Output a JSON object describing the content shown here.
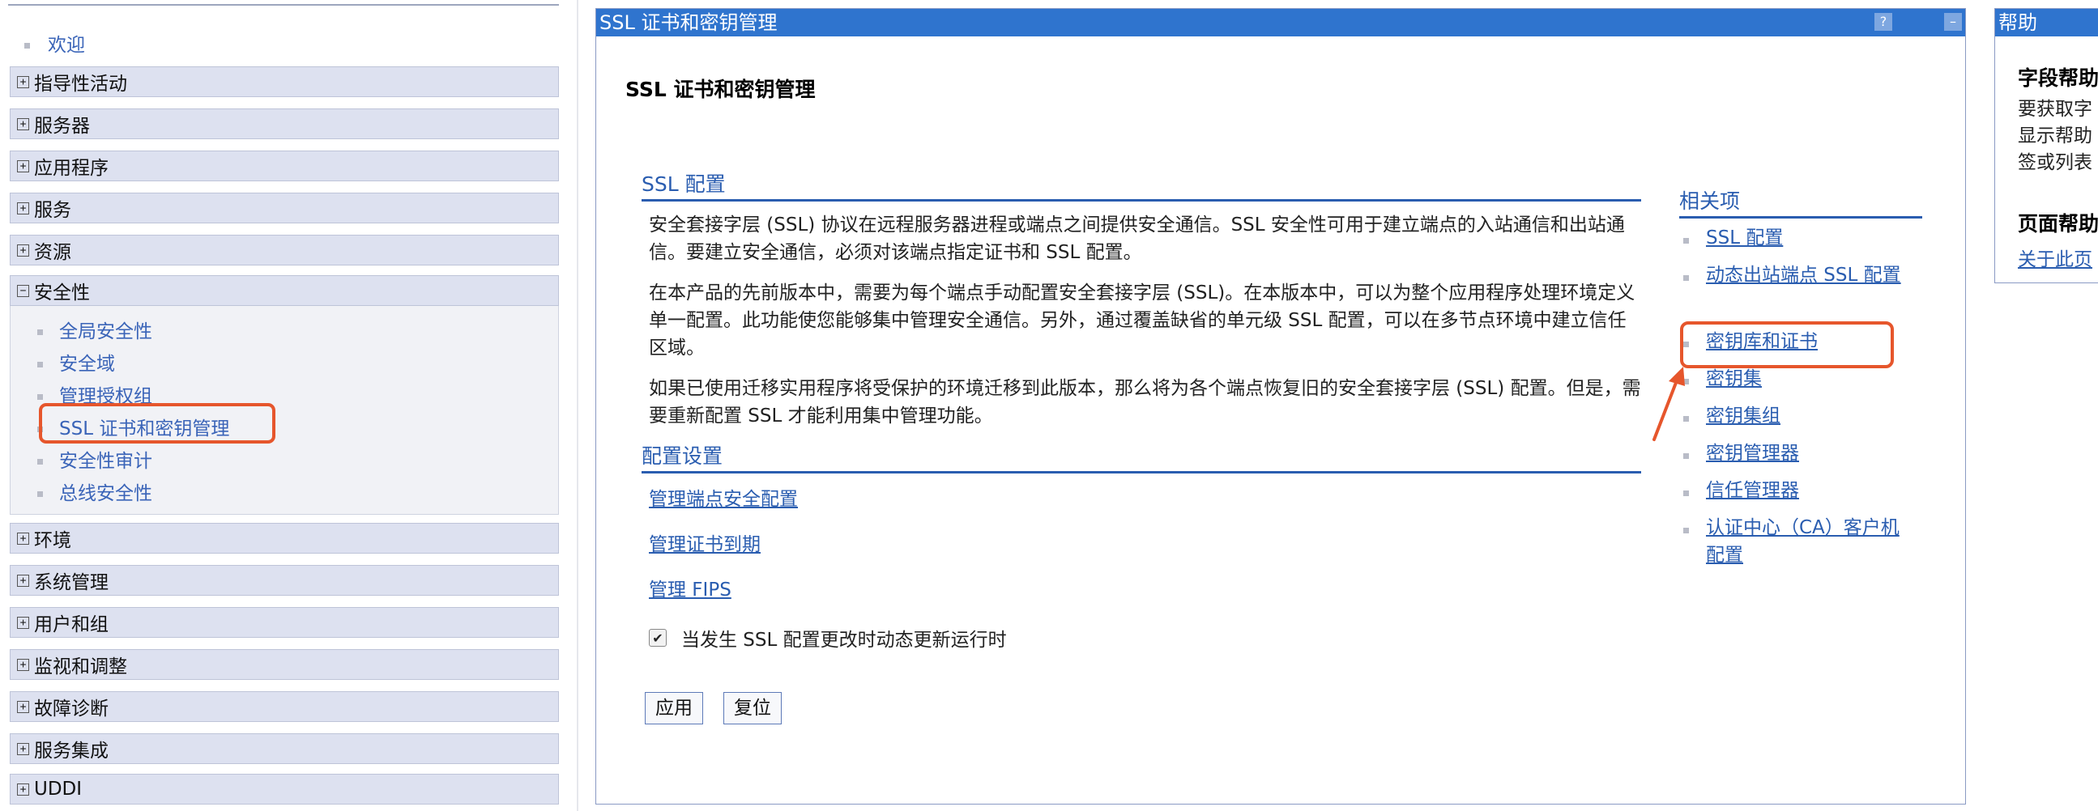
{
  "nav": {
    "welcome": "欢迎",
    "sections": [
      "指导性活动",
      "服务器",
      "应用程序",
      "服务",
      "资源"
    ],
    "security": {
      "label": "安全性",
      "items": [
        "全局安全性",
        "安全域",
        "管理授权组",
        "SSL 证书和密钥管理",
        "安全性审计",
        "总线安全性"
      ]
    },
    "sections_after": [
      "环境",
      "系统管理",
      "用户和组",
      "监视和调整",
      "故障诊断",
      "服务集成",
      "UDDI"
    ]
  },
  "main": {
    "title_bar": "SSL 证书和密钥管理",
    "help_btn": "?",
    "min_btn": "–",
    "heading": "SSL 证书和密钥管理",
    "ssl_config_heading": "SSL 配置",
    "paragraphs": [
      "安全套接字层 (SSL) 协议在远程服务器进程或端点之间提供安全通信。SSL 安全性可用于建立端点的入站通信和出站通信。要建立安全通信，必须对该端点指定证书和 SSL 配置。",
      "在本产品的先前版本中，需要为每个端点手动配置安全套接字层 (SSL)。在本版本中，可以为整个应用程序处理环境定义单一配置。此功能使您能够集中管理安全通信。另外，通过覆盖缺省的单元级 SSL 配置，可以在多节点环境中建立信任区域。",
      "如果已使用迁移实用程序将受保护的环境迁移到此版本，那么将为各个端点恢复旧的安全套接字层 (SSL) 配置。但是，需要重新配置 SSL 才能利用集中管理功能。"
    ],
    "config_settings_heading": "配置设置",
    "config_links": [
      "管理端点安全配置",
      "管理证书到期",
      "管理 FIPS"
    ],
    "checkbox_label": "当发生 SSL 配置更改时动态更新运行时",
    "checkbox_checked": "✔",
    "apply": "应用",
    "reset": "复位",
    "related_heading": "相关项",
    "related": [
      "SSL 配置",
      "动态出站端点 SSL 配置",
      "密钥库和证书",
      "密钥集",
      "密钥集组",
      "密钥管理器",
      "信任管理器",
      "认证中心（CA）客户机配置"
    ]
  },
  "help": {
    "title": "帮助",
    "field_help": "字段帮助",
    "field_lines": [
      "要获取字",
      "显示帮助",
      "签或列表"
    ],
    "page_help": "页面帮助",
    "page_link": "关于此页"
  },
  "colors": {
    "title_bar": "#2f74ce",
    "link": "#2a5db0",
    "highlight": "#e6562c",
    "nav_bg": "#dde1f0"
  }
}
